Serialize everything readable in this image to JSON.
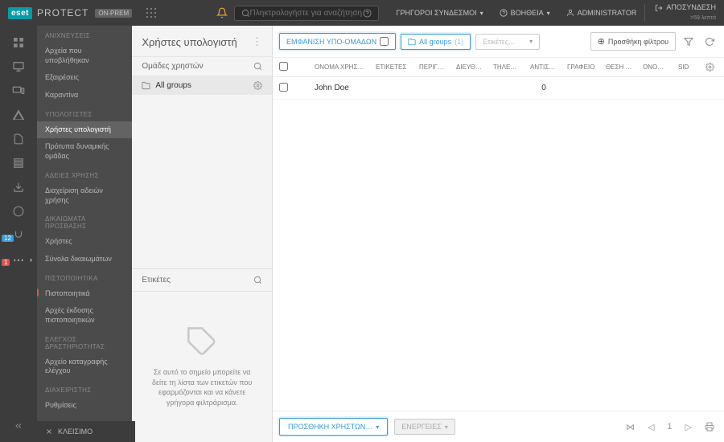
{
  "header": {
    "brand": "eset",
    "product": "PROTECT",
    "suffix": "ON-PREM",
    "search_placeholder": "Πληκτρολογήστε για αναζήτηση...",
    "links": {
      "quick": "ΓΡΗΓΟΡΟΙ ΣΥΝΔΕΣΜΟΙ",
      "help": "ΒΟΗΘΕΙΑ",
      "admin": "ADMINISTRATOR",
      "logout": "ΑΠΟΣΥΝΔΕΣΗ",
      "logout_sub": ">59 λεπτά"
    }
  },
  "iconbar": {
    "badge_blue": "12",
    "badge_red": "1"
  },
  "sidebar": {
    "sections": [
      {
        "title": "ΑΝΙΧΝΕΥΣΕΙΣ",
        "items": [
          "Αρχεία που υποβλήθηκαν",
          "Εξαιρέσεις",
          "Καραντίνα"
        ]
      },
      {
        "title": "ΥΠΟΛΟΓΙΣΤΕΣ",
        "items": [
          "Χρήστες υπολογιστή",
          "Πρότυπα δυναμικής ομάδας"
        ]
      },
      {
        "title": "ΑΔΕΙΕΣ ΧΡΗΣΗΣ",
        "items": [
          "Διαχείριση αδειών χρήσης"
        ]
      },
      {
        "title": "ΔΙΚΑΙΩΜΑΤΑ ΠΡΟΣΒΑΣΗΣ",
        "items": [
          "Χρήστες",
          "Σύνολα δικαιωμάτων"
        ]
      },
      {
        "title": "ΠΙΣΤΟΠΟΙΗΤΙΚΑ",
        "items": [
          "Πιστοποιητικά",
          "Αρχές έκδοσης πιστοποιητικών"
        ]
      },
      {
        "title": "ΕΛΕΓΧΟΣ ΔΡΑΣΤΗΡΙΟΤΗΤΑΣ",
        "items": [
          "Αρχείο καταγραφής ελέγχου"
        ]
      },
      {
        "title": "ΔΙΑΧΕΙΡΙΣΤΗΣ",
        "items": [
          "Ρυθμίσεις"
        ]
      }
    ],
    "active": "Χρήστες υπολογιστή",
    "flagged": "Πιστοποιητικά",
    "close": "ΚΛΕΙΣΙΜΟ"
  },
  "panel": {
    "title": "Χρήστες υπολογιστή",
    "groups_label": "Ομάδες χρηστών",
    "tree_root": "All groups",
    "tags_label": "Ετικέτες",
    "tags_empty": "Σε αυτό το σημείο μπορείτε να δείτε τη λίστα των ετικετών που εφαρμόζονται και να κάνετε γρήγορα φιλτράρισμα."
  },
  "toolbar": {
    "show_subgroups": "ΕΜΦΑΝΙΣΗ ΥΠΟ-ΟΜΑΔΩΝ",
    "group_chip": "All groups",
    "group_count": "(1)",
    "tag_filter": "Ετικέτες...",
    "add_filter": "Προσθήκη φίλτρου"
  },
  "table": {
    "columns": [
      "ΟΝΟΜΑ ΧΡΗΣΤΗ",
      "ΕΤΙΚΕΤΕΣ",
      "ΠΕΡΙΓΡ…",
      "ΔΙΕΥΘΥ…",
      "ΤΗΛΕΦ…",
      "ΑΝΤΙΣ…",
      "ΓΡΑΦΕΙΟ",
      "ΘΕΣΗ Ε…",
      "ΟΝΟΜ…",
      "SID"
    ],
    "rows": [
      {
        "name": "John Doe",
        "tags": "",
        "desc": "",
        "addr": "",
        "phone": "",
        "assign": "0",
        "office": "",
        "pos": "",
        "onom": "",
        "sid": ""
      }
    ]
  },
  "footer": {
    "add_users": "ΠΡΟΣΘΗΚΗ ΧΡΗΣΤΩΝ…",
    "actions": "ΕΝΕΡΓΕΙΕΣ",
    "page": "1"
  }
}
